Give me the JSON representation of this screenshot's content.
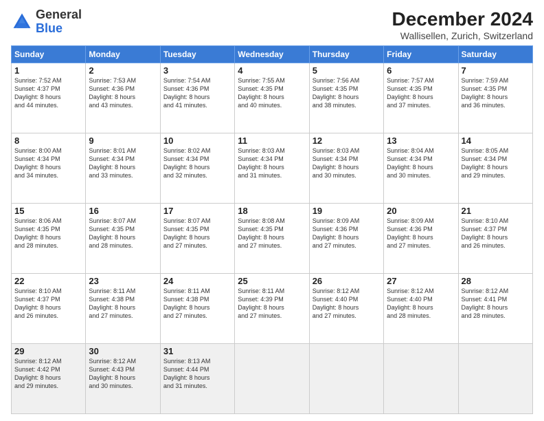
{
  "header": {
    "logo_general": "General",
    "logo_blue": "Blue",
    "month_title": "December 2024",
    "location": "Wallisellen, Zurich, Switzerland"
  },
  "days_of_week": [
    "Sunday",
    "Monday",
    "Tuesday",
    "Wednesday",
    "Thursday",
    "Friday",
    "Saturday"
  ],
  "weeks": [
    [
      {
        "day": "1",
        "sunrise": "7:52 AM",
        "sunset": "4:37 PM",
        "daylight": "8 hours and 44 minutes."
      },
      {
        "day": "2",
        "sunrise": "7:53 AM",
        "sunset": "4:36 PM",
        "daylight": "8 hours and 43 minutes."
      },
      {
        "day": "3",
        "sunrise": "7:54 AM",
        "sunset": "4:36 PM",
        "daylight": "8 hours and 41 minutes."
      },
      {
        "day": "4",
        "sunrise": "7:55 AM",
        "sunset": "4:35 PM",
        "daylight": "8 hours and 40 minutes."
      },
      {
        "day": "5",
        "sunrise": "7:56 AM",
        "sunset": "4:35 PM",
        "daylight": "8 hours and 38 minutes."
      },
      {
        "day": "6",
        "sunrise": "7:57 AM",
        "sunset": "4:35 PM",
        "daylight": "8 hours and 37 minutes."
      },
      {
        "day": "7",
        "sunrise": "7:59 AM",
        "sunset": "4:35 PM",
        "daylight": "8 hours and 36 minutes."
      }
    ],
    [
      {
        "day": "8",
        "sunrise": "8:00 AM",
        "sunset": "4:34 PM",
        "daylight": "8 hours and 34 minutes."
      },
      {
        "day": "9",
        "sunrise": "8:01 AM",
        "sunset": "4:34 PM",
        "daylight": "8 hours and 33 minutes."
      },
      {
        "day": "10",
        "sunrise": "8:02 AM",
        "sunset": "4:34 PM",
        "daylight": "8 hours and 32 minutes."
      },
      {
        "day": "11",
        "sunrise": "8:03 AM",
        "sunset": "4:34 PM",
        "daylight": "8 hours and 31 minutes."
      },
      {
        "day": "12",
        "sunrise": "8:03 AM",
        "sunset": "4:34 PM",
        "daylight": "8 hours and 30 minutes."
      },
      {
        "day": "13",
        "sunrise": "8:04 AM",
        "sunset": "4:34 PM",
        "daylight": "8 hours and 30 minutes."
      },
      {
        "day": "14",
        "sunrise": "8:05 AM",
        "sunset": "4:34 PM",
        "daylight": "8 hours and 29 minutes."
      }
    ],
    [
      {
        "day": "15",
        "sunrise": "8:06 AM",
        "sunset": "4:35 PM",
        "daylight": "8 hours and 28 minutes."
      },
      {
        "day": "16",
        "sunrise": "8:07 AM",
        "sunset": "4:35 PM",
        "daylight": "8 hours and 28 minutes."
      },
      {
        "day": "17",
        "sunrise": "8:07 AM",
        "sunset": "4:35 PM",
        "daylight": "8 hours and 27 minutes."
      },
      {
        "day": "18",
        "sunrise": "8:08 AM",
        "sunset": "4:35 PM",
        "daylight": "8 hours and 27 minutes."
      },
      {
        "day": "19",
        "sunrise": "8:09 AM",
        "sunset": "4:36 PM",
        "daylight": "8 hours and 27 minutes."
      },
      {
        "day": "20",
        "sunrise": "8:09 AM",
        "sunset": "4:36 PM",
        "daylight": "8 hours and 27 minutes."
      },
      {
        "day": "21",
        "sunrise": "8:10 AM",
        "sunset": "4:37 PM",
        "daylight": "8 hours and 26 minutes."
      }
    ],
    [
      {
        "day": "22",
        "sunrise": "8:10 AM",
        "sunset": "4:37 PM",
        "daylight": "8 hours and 26 minutes."
      },
      {
        "day": "23",
        "sunrise": "8:11 AM",
        "sunset": "4:38 PM",
        "daylight": "8 hours and 27 minutes."
      },
      {
        "day": "24",
        "sunrise": "8:11 AM",
        "sunset": "4:38 PM",
        "daylight": "8 hours and 27 minutes."
      },
      {
        "day": "25",
        "sunrise": "8:11 AM",
        "sunset": "4:39 PM",
        "daylight": "8 hours and 27 minutes."
      },
      {
        "day": "26",
        "sunrise": "8:12 AM",
        "sunset": "4:40 PM",
        "daylight": "8 hours and 27 minutes."
      },
      {
        "day": "27",
        "sunrise": "8:12 AM",
        "sunset": "4:40 PM",
        "daylight": "8 hours and 28 minutes."
      },
      {
        "day": "28",
        "sunrise": "8:12 AM",
        "sunset": "4:41 PM",
        "daylight": "8 hours and 28 minutes."
      }
    ],
    [
      {
        "day": "29",
        "sunrise": "8:12 AM",
        "sunset": "4:42 PM",
        "daylight": "8 hours and 29 minutes."
      },
      {
        "day": "30",
        "sunrise": "8:12 AM",
        "sunset": "4:43 PM",
        "daylight": "8 hours and 30 minutes."
      },
      {
        "day": "31",
        "sunrise": "8:13 AM",
        "sunset": "4:44 PM",
        "daylight": "8 hours and 31 minutes."
      },
      null,
      null,
      null,
      null
    ]
  ],
  "labels": {
    "sunrise": "Sunrise:",
    "sunset": "Sunset:",
    "daylight": "Daylight:"
  }
}
